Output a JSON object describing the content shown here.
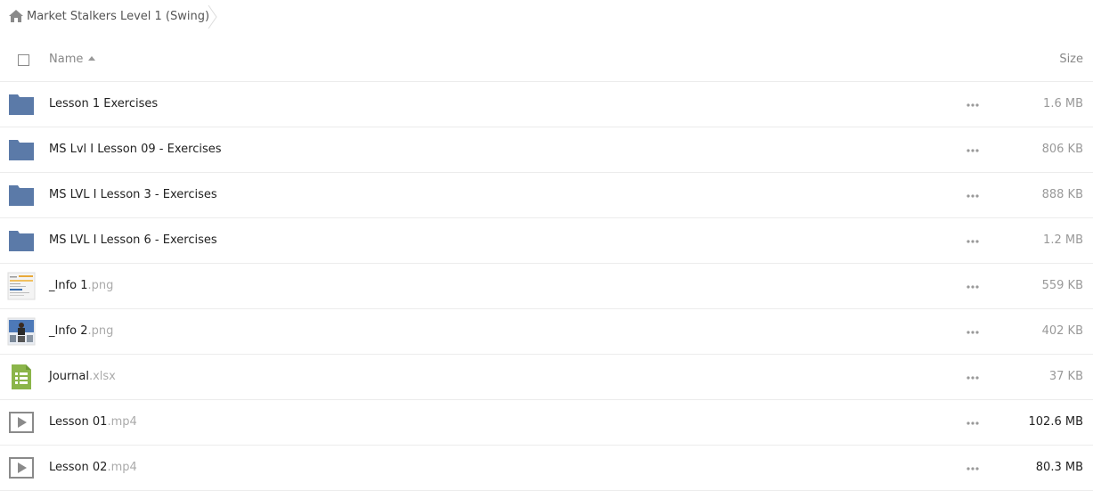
{
  "breadcrumb": {
    "home_icon": "home-icon",
    "current_folder": "Market Stalkers Level 1 (Swing)"
  },
  "header": {
    "name_label": "Name",
    "size_label": "Size"
  },
  "colors": {
    "folder": "#5b7aa8",
    "spreadsheet": "#8bb54a",
    "text": "#222222",
    "muted": "#999999",
    "divider": "#ececec"
  },
  "files": [
    {
      "type": "folder",
      "icon": "folder-icon",
      "name": "Lesson 1 Exercises",
      "ext": "",
      "size": "1.6 MB"
    },
    {
      "type": "folder",
      "icon": "folder-icon",
      "name": "MS Lvl I Lesson 09 - Exercises",
      "ext": "",
      "size": "806 KB"
    },
    {
      "type": "folder",
      "icon": "folder-icon",
      "name": "MS LVL I Lesson 3 - Exercises",
      "ext": "",
      "size": "888 KB"
    },
    {
      "type": "folder",
      "icon": "folder-icon",
      "name": "MS LVL I Lesson 6 - Exercises",
      "ext": "",
      "size": "1.2 MB"
    },
    {
      "type": "image",
      "icon": "image-thumbnail-icon",
      "name": "_Info 1",
      "ext": ".png",
      "size": "559 KB"
    },
    {
      "type": "image2",
      "icon": "image-thumbnail-icon",
      "name": "_Info 2",
      "ext": ".png",
      "size": "402 KB"
    },
    {
      "type": "spreadsheet",
      "icon": "spreadsheet-icon",
      "name": "Journal",
      "ext": ".xlsx",
      "size": "37 KB"
    },
    {
      "type": "video",
      "icon": "video-icon",
      "name": "Lesson 01",
      "ext": ".mp4",
      "size": "102.6 MB"
    },
    {
      "type": "video",
      "icon": "video-icon",
      "name": "Lesson 02",
      "ext": ".mp4",
      "size": "80.3 MB"
    }
  ]
}
